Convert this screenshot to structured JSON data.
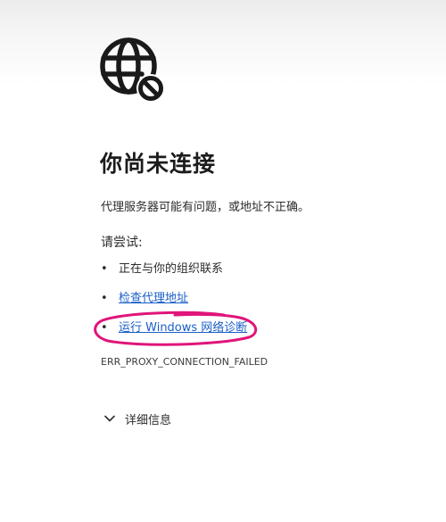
{
  "error_page": {
    "title": "你尚未连接",
    "description": "代理服务器可能有问题，或地址不正确。",
    "try_heading": "请尝试:",
    "suggestions": [
      {
        "bullet": "•",
        "text": "正在与你的组织联系"
      },
      {
        "bullet": "•",
        "text": "检查代理地址"
      },
      {
        "bullet": "•",
        "text": "运行 Windows 网络诊断"
      }
    ],
    "error_code": "ERR_PROXY_CONNECTION_FAILED",
    "details_label": "详细信息"
  },
  "icons": {
    "status": "globe-blocked-icon",
    "details": "chevron-down-icon"
  },
  "colors": {
    "link": "#1a5fc8",
    "annotation": "#e0157a",
    "text": "#2b2b2b"
  }
}
